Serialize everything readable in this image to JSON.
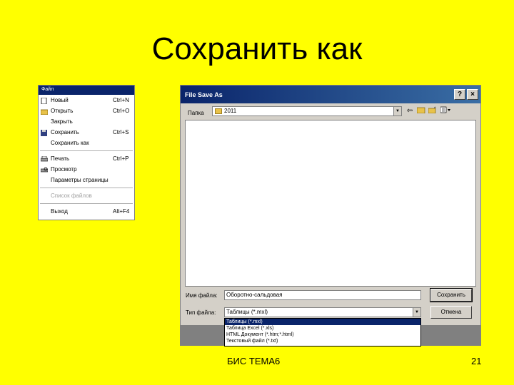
{
  "slide": {
    "title": "Сохранить как",
    "footer": "БИС ТЕМА6",
    "page_number": "21"
  },
  "file_menu": {
    "header": "Файл",
    "items": [
      {
        "label": "Новый",
        "shortcut": "Ctrl+N",
        "icon": "new-document-icon"
      },
      {
        "label": "Открыть",
        "shortcut": "Ctrl+O",
        "icon": "open-folder-icon"
      },
      {
        "label": "Закрыть",
        "shortcut": ""
      },
      {
        "label": "Сохранить",
        "shortcut": "Ctrl+S",
        "icon": "save-disk-icon"
      },
      {
        "label": "Сохранить как",
        "shortcut": ""
      },
      {
        "label": "Печать",
        "shortcut": "Ctrl+P",
        "icon": "printer-icon"
      },
      {
        "label": "Просмотр",
        "shortcut": "",
        "icon": "preview-icon"
      },
      {
        "label": "Параметры страницы",
        "shortcut": ""
      },
      {
        "label": "Список файлов",
        "shortcut": "",
        "disabled": true
      },
      {
        "label": "Выход",
        "shortcut": "Alt+F4"
      }
    ]
  },
  "dialog": {
    "title": "File Save As",
    "help_btn": "?",
    "close_btn": "×",
    "lookin_label": "Папка",
    "lookin_value": "2011",
    "filename_label": "Имя файла:",
    "filename_value": "Оборотно-сальдовая",
    "filetype_label": "Тип файла:",
    "filetype_value": "Таблицы (*.mxl)",
    "save_label": "Сохранить",
    "cancel_label": "Отмена",
    "type_options": [
      "Таблицы (*.mxl)",
      "Таблица Excel (*.xls)",
      "HTML Документ (*.htm;*.html)",
      "Текстовый файл (*.txt)"
    ],
    "selected_type_index": 0
  }
}
